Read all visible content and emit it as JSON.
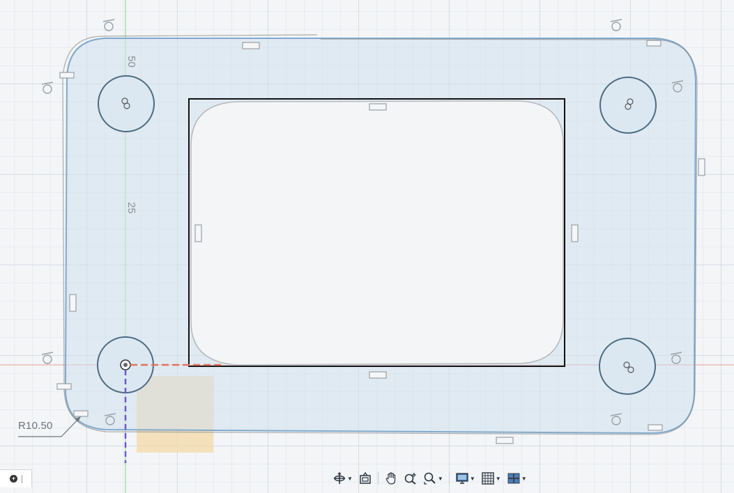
{
  "viewport": {
    "dimensions": [
      {
        "id": "dim-50",
        "text": "50"
      },
      {
        "id": "dim-25",
        "text": "25"
      }
    ],
    "radius_annotation": "R10.50"
  },
  "colors": {
    "body_fill": "#cfe0ee",
    "body_outline": "#7fa9cc",
    "pencil_stroke": "#8c8c8c",
    "rectangle_stroke": "#111111",
    "x_axis": "#e3735c",
    "y_axis": "#8fd18f",
    "selection_fill": "#f4d9a8",
    "origin_axis_dash": "#6a5acd"
  },
  "toolbar": {
    "buttons": [
      {
        "name": "orbit-button",
        "icon": "orbit-icon",
        "has_dropdown": true
      },
      {
        "name": "look-at-button",
        "icon": "look-at-icon",
        "has_dropdown": false
      },
      {
        "name": "pan-button",
        "icon": "hand-icon",
        "has_dropdown": false
      },
      {
        "name": "zoom-button",
        "icon": "zoom-icon",
        "has_dropdown": false
      },
      {
        "name": "fit-button",
        "icon": "zoom-window-icon",
        "has_dropdown": true
      },
      {
        "name": "display-settings-button",
        "icon": "display-icon",
        "has_dropdown": true
      },
      {
        "name": "grid-settings-button",
        "icon": "grid-icon",
        "has_dropdown": true
      },
      {
        "name": "viewports-button",
        "icon": "viewports-icon",
        "has_dropdown": true
      }
    ]
  }
}
